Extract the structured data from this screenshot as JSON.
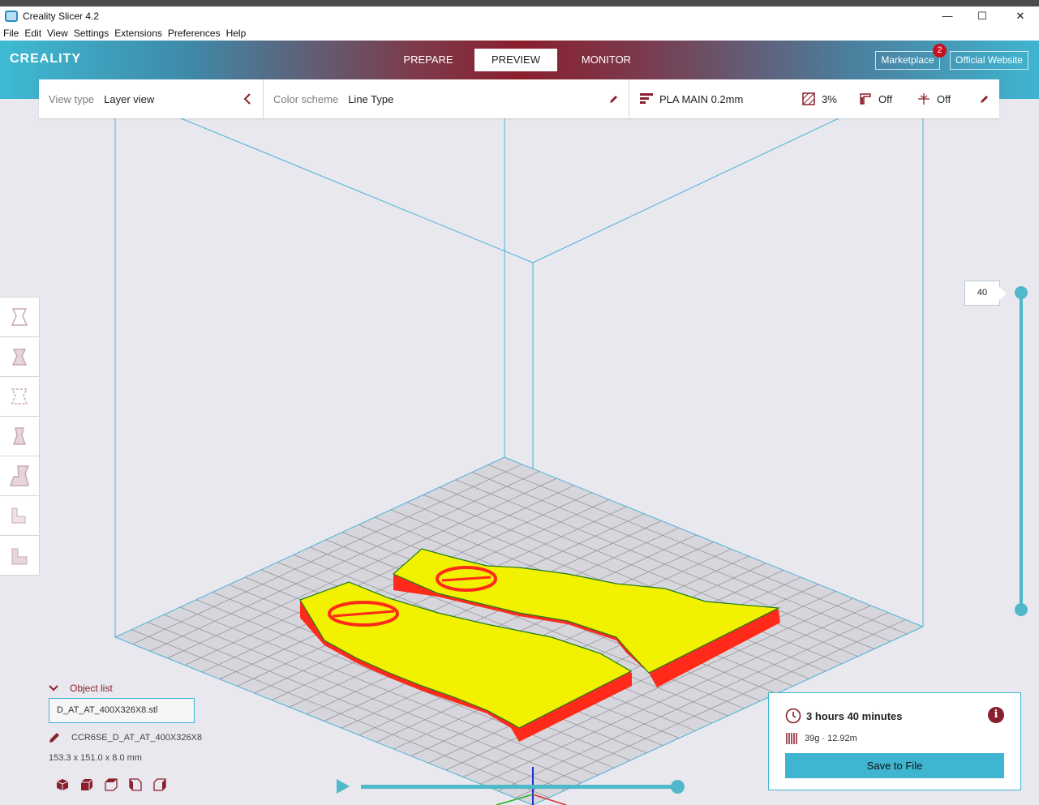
{
  "window": {
    "title": "Creality Slicer 4.2"
  },
  "menu": [
    "File",
    "Edit",
    "View",
    "Settings",
    "Extensions",
    "Preferences",
    "Help"
  ],
  "header": {
    "logo": "CREALITY",
    "tabs": [
      "PREPARE",
      "PREVIEW",
      "MONITOR"
    ],
    "active_tab": "PREVIEW",
    "marketplace_label": "Marketplace",
    "marketplace_badge": "2",
    "website_label": "Official Website"
  },
  "topbar": {
    "view_type_label": "View type",
    "view_type_value": "Layer view",
    "color_scheme_label": "Color scheme",
    "color_scheme_value": "Line Type",
    "profile": "PLA MAIN 0.2mm",
    "infill": "3%",
    "support": "Off",
    "adhesion": "Off"
  },
  "layer_slider": {
    "current_layer": "40",
    "value": 40
  },
  "object_list": {
    "header": "Object list",
    "file": "D_AT_AT_400X326X8.stl",
    "machine_name": "CCR6SE_D_AT_AT_400X326X8",
    "dimensions": "153.3 x 151.0 x 8.0 mm"
  },
  "print_info": {
    "time": "3 hours 40 minutes",
    "material": "39g · 12.92m",
    "save_label": "Save to File"
  },
  "colors": {
    "accent": "#3fb5d1",
    "brand": "#8a1f2d",
    "model_wall": "#ff2a1a",
    "model_top": "#f4f400"
  },
  "icons": {
    "left_tools": [
      "rotate-tool-icon",
      "scale-tool-icon",
      "mirror-tool-icon",
      "per-model-settings-icon",
      "support-blocker-icon",
      "layer-stair-icon",
      "layer-stair-solid-icon"
    ],
    "camera_views": [
      "3d-view-icon",
      "front-view-icon",
      "top-view-icon",
      "left-view-icon",
      "right-view-icon"
    ]
  }
}
